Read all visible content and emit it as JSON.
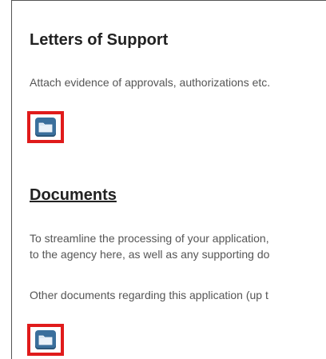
{
  "letters_section": {
    "title": "Letters of Support",
    "description": "Attach evidence of approvals, authorizations etc.",
    "folder_icon": "folder-icon"
  },
  "documents_section": {
    "title": "Documents",
    "line1": "To streamline the processing of your application,",
    "line2": "to the agency here, as well as any supporting do",
    "line3": "Other documents regarding this application (up t",
    "folder_icon": "folder-icon"
  },
  "colors": {
    "highlight": "#e01b1b",
    "icon_fill": "#3a6f9c"
  }
}
